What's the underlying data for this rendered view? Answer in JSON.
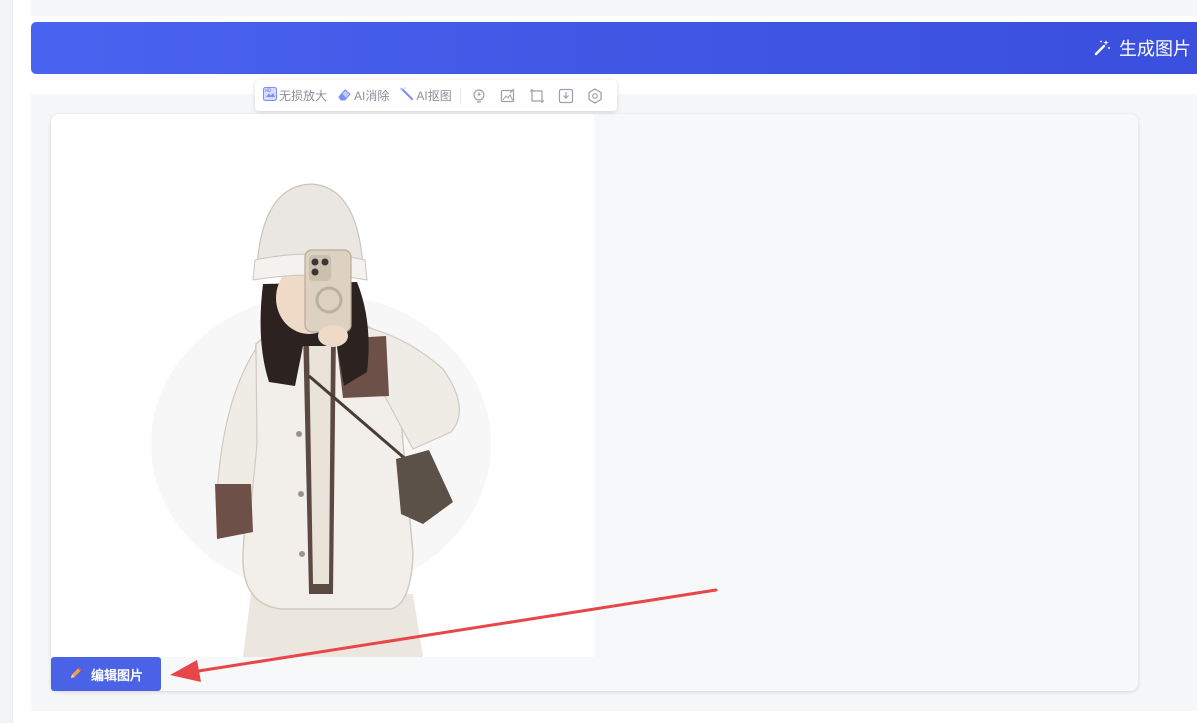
{
  "header": {
    "generate_label": "生成图片",
    "generate_icon": "magic-wand-icon"
  },
  "toolbar": {
    "hd_label": "无损放大",
    "erase_label": "AI消除",
    "cutout_label": "AI抠图",
    "icons": [
      "bulb-icon",
      "image-edit-icon",
      "crop-icon",
      "download-icon",
      "settings-icon"
    ]
  },
  "result": {
    "edit_label": "编辑图片",
    "edit_icon": "pencil-icon"
  },
  "annotation": {
    "arrow_color": "#e8474a"
  },
  "colors": {
    "accent": "#4a63e6",
    "panel": "#f6f7f9"
  }
}
